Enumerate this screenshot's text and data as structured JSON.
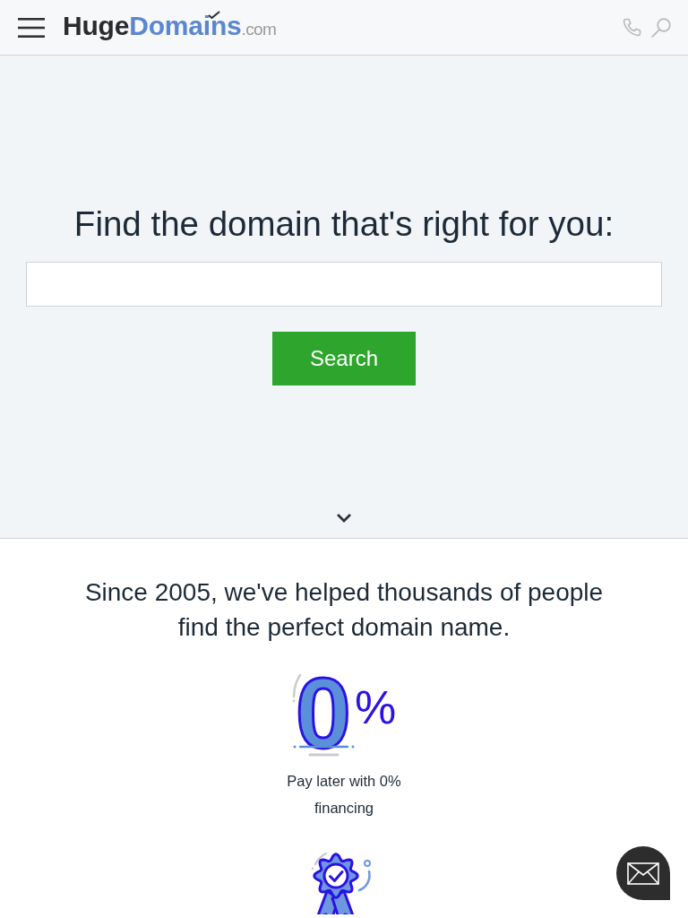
{
  "header": {
    "logo": {
      "primary": "Huge",
      "accent": "Domains",
      "suffix": ".com"
    }
  },
  "hero": {
    "title": "Find the domain that's right for you:",
    "button": "Search"
  },
  "features": {
    "intro": "Since 2005, we've helped thousands of people find the perfect domain name.",
    "items": [
      {
        "kind": "percent",
        "numeral": "0",
        "symbol": "%",
        "caption": "Pay later with 0% financing"
      },
      {
        "kind": "award"
      }
    ]
  }
}
